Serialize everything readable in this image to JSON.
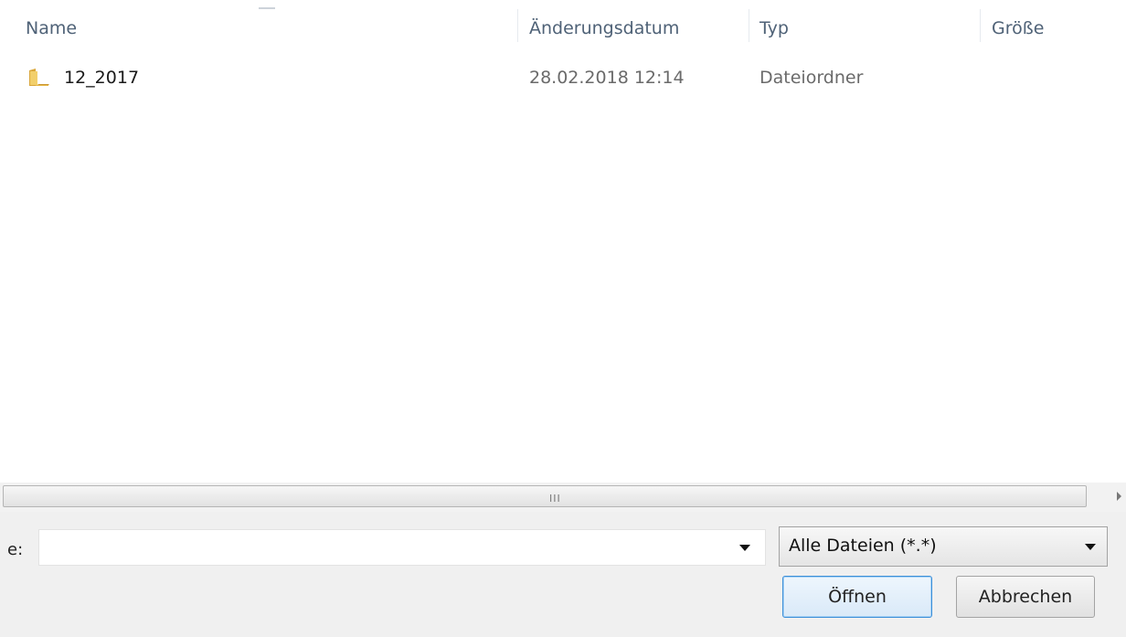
{
  "file_list": {
    "columns": [
      {
        "key": "name",
        "label": "Name"
      },
      {
        "key": "modified",
        "label": "Änderungsdatum"
      },
      {
        "key": "type",
        "label": "Typ"
      },
      {
        "key": "size",
        "label": "Größe"
      }
    ],
    "rows": [
      {
        "name": "12_2017",
        "modified": "28.02.2018 12:14",
        "type": "Dateiordner",
        "size": ""
      }
    ]
  },
  "scrollbar": {
    "grip": "III"
  },
  "filename": {
    "label": "e:",
    "value": ""
  },
  "filter": {
    "selected": "Alle Dateien (*.*)"
  },
  "buttons": {
    "open": "Öffnen",
    "cancel": "Abbrechen"
  },
  "colors": {
    "folder": "#e8b94a",
    "header_text": "#4f6277",
    "primary_border": "#3c8fd9"
  },
  "icons": {
    "folder": "folder-icon",
    "dropdown": "chevron-down-icon"
  }
}
